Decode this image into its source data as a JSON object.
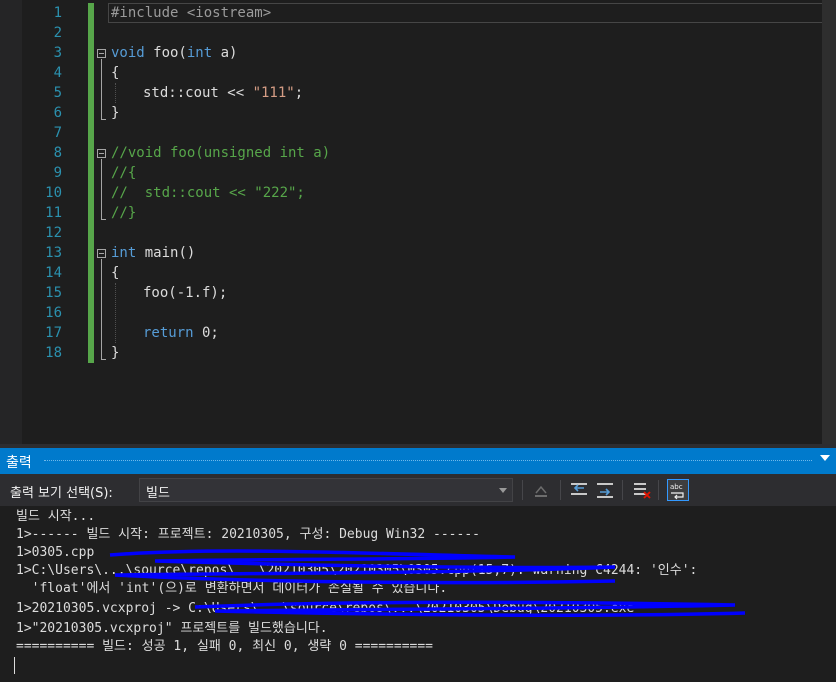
{
  "editor": {
    "lines": [
      {
        "n": "1",
        "indent": 0,
        "tokens": [
          {
            "c": "pp",
            "t": "#include <iostream>"
          }
        ]
      },
      {
        "n": "2",
        "indent": 0,
        "tokens": []
      },
      {
        "n": "3",
        "indent": 0,
        "tokens": [
          {
            "c": "kw",
            "t": "void"
          },
          {
            "c": "",
            "t": " foo("
          },
          {
            "c": "kw",
            "t": "int"
          },
          {
            "c": "",
            "t": " a)"
          }
        ]
      },
      {
        "n": "4",
        "indent": 0,
        "tokens": [
          {
            "c": "",
            "t": "{"
          }
        ]
      },
      {
        "n": "5",
        "indent": 1,
        "tokens": [
          {
            "c": "",
            "t": "std::cout << "
          },
          {
            "c": "str",
            "t": "\"111\""
          },
          {
            "c": "",
            "t": ";"
          }
        ]
      },
      {
        "n": "6",
        "indent": 0,
        "tokens": [
          {
            "c": "",
            "t": "}"
          }
        ]
      },
      {
        "n": "7",
        "indent": 0,
        "tokens": []
      },
      {
        "n": "8",
        "indent": 0,
        "tokens": [
          {
            "c": "cmt",
            "t": "//void foo(unsigned int a)"
          }
        ]
      },
      {
        "n": "9",
        "indent": 0,
        "tokens": [
          {
            "c": "cmt",
            "t": "//{"
          }
        ]
      },
      {
        "n": "10",
        "indent": 0,
        "tokens": [
          {
            "c": "cmt",
            "t": "//  std::cout << \"222\";"
          }
        ]
      },
      {
        "n": "11",
        "indent": 0,
        "tokens": [
          {
            "c": "cmt",
            "t": "//}"
          }
        ]
      },
      {
        "n": "12",
        "indent": 0,
        "tokens": []
      },
      {
        "n": "13",
        "indent": 0,
        "tokens": [
          {
            "c": "kw",
            "t": "int"
          },
          {
            "c": "",
            "t": " main()"
          }
        ]
      },
      {
        "n": "14",
        "indent": 0,
        "tokens": [
          {
            "c": "",
            "t": "{"
          }
        ]
      },
      {
        "n": "15",
        "indent": 1,
        "tokens": [
          {
            "c": "",
            "t": "foo(-1.f);"
          }
        ]
      },
      {
        "n": "16",
        "indent": 0,
        "tokens": []
      },
      {
        "n": "17",
        "indent": 1,
        "tokens": [
          {
            "c": "kw",
            "t": "return"
          },
          {
            "c": "",
            "t": " 0;"
          }
        ]
      },
      {
        "n": "18",
        "indent": 0,
        "tokens": [
          {
            "c": "",
            "t": "}"
          }
        ]
      }
    ]
  },
  "output_panel": {
    "title": "출력",
    "source_label": "출력 보기 선택(S):",
    "source_value": "빌드",
    "toolbar": {
      "clear_icon": "clear-all-icon",
      "prev_icon": "go-to-previous-message-icon",
      "next_icon": "go-to-next-message-icon",
      "clear_all_icon": "clear-all-icon",
      "wrap_icon": "word-wrap-icon"
    },
    "lines": [
      "빌드 시작...",
      "1>------ 빌드 시작: 프로젝트: 20210305, 구성: Debug Win32 ------",
      "1>0305.cpp",
      "1>C:\\Users\\...\\source\\repos\\...\\20210305\\20210305\\0305.cpp(15,7): warning C4244: '인수':",
      "  'float'에서 'int'(으)로 변환하면서 데이터가 손실될 수 있습니다.",
      "1>20210305.vcxproj -> C:\\Users\\...\\source\\repos\\...\\20210305\\Debug\\20210305.exe",
      "1>\"20210305.vcxproj\" 프로젝트를 빌드했습니다.",
      "========== 빌드: 성공 1, 실패 0, 최신 0, 생략 0 =========="
    ]
  },
  "colors": {
    "editor_bg": "#1e1e1e",
    "line_number": "#2b91af",
    "keyword": "#569cd6",
    "string": "#d69d85",
    "comment": "#57a64a",
    "panel_title_bg": "#007acc",
    "redaction_scribble": "#0000ff"
  }
}
